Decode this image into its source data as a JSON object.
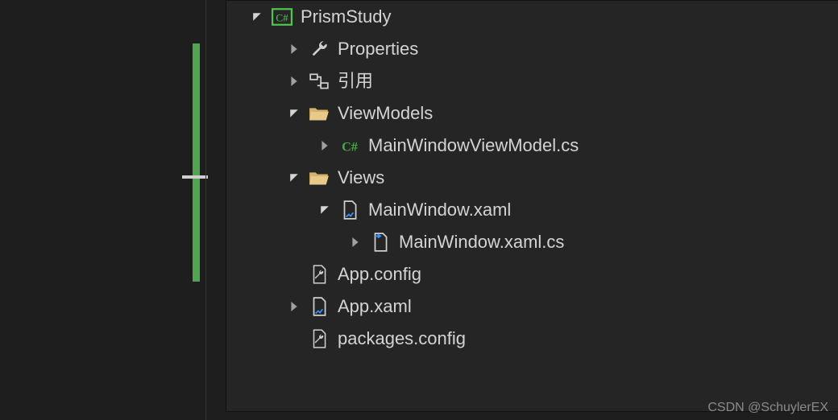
{
  "tree": {
    "project": {
      "label": "PrismStudy",
      "expanded": true,
      "icon": "csharp-project-icon"
    },
    "nodes": [
      {
        "label": "Properties",
        "icon": "wrench-icon",
        "expanded": false,
        "indent": 1,
        "name": "properties-node"
      },
      {
        "label": "引用",
        "icon": "references-icon",
        "expanded": false,
        "indent": 1,
        "name": "references-node"
      },
      {
        "label": "ViewModels",
        "icon": "folder-open-icon",
        "expanded": true,
        "indent": 1,
        "name": "viewmodels-folder"
      },
      {
        "label": "MainWindowViewModel.cs",
        "icon": "csharp-file-icon",
        "expanded": false,
        "indent": 2,
        "name": "mainwindowviewmodel-file"
      },
      {
        "label": "Views",
        "icon": "folder-open-icon",
        "expanded": true,
        "indent": 1,
        "name": "views-folder"
      },
      {
        "label": "MainWindow.xaml",
        "icon": "xaml-file-icon",
        "expanded": true,
        "indent": 2,
        "name": "mainwindow-xaml-file"
      },
      {
        "label": "MainWindow.xaml.cs",
        "icon": "codebehind-file-icon",
        "expanded": false,
        "indent": 3,
        "name": "mainwindow-xaml-cs-file"
      },
      {
        "label": "App.config",
        "icon": "wrench-file-icon",
        "expanded": null,
        "indent": 1,
        "name": "appconfig-file"
      },
      {
        "label": "App.xaml",
        "icon": "xaml-file-icon",
        "expanded": false,
        "indent": 1,
        "name": "appxaml-file"
      },
      {
        "label": "packages.config",
        "icon": "wrench-file-icon",
        "expanded": null,
        "indent": 1,
        "name": "packagesconfig-file"
      }
    ]
  },
  "watermark": "CSDN @SchuylerEX"
}
